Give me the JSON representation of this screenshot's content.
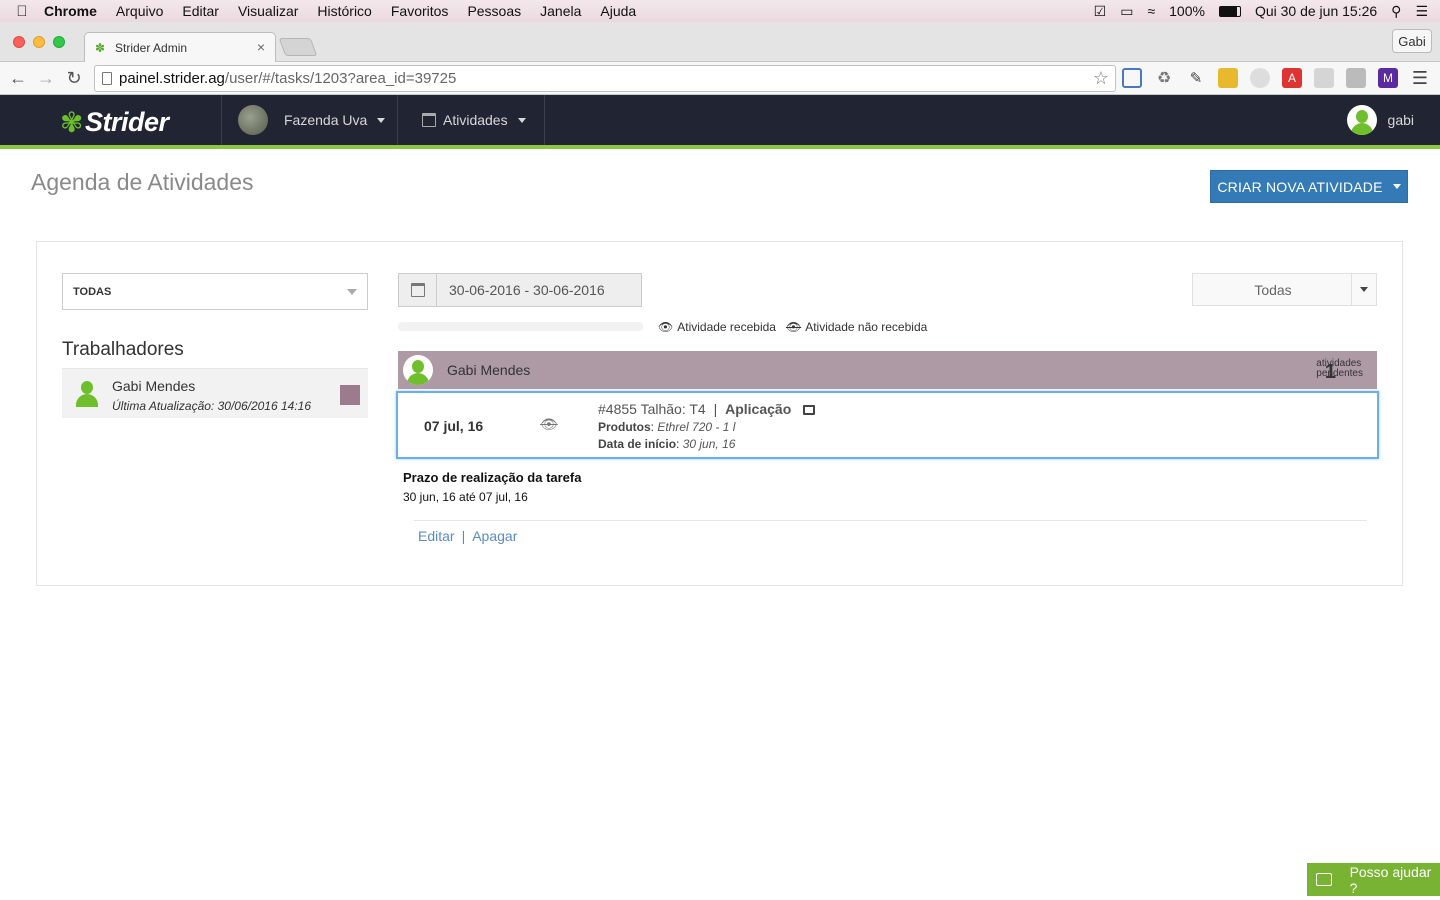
{
  "os_menubar": {
    "app_name": "Chrome",
    "menus": [
      "Arquivo",
      "Editar",
      "Visualizar",
      "Histórico",
      "Favoritos",
      "Pessoas",
      "Janela",
      "Ajuda"
    ],
    "battery": "100%",
    "clock": "Qui 30 de jun  15:26"
  },
  "browser": {
    "tab_title": "Strider Admin",
    "profile_label": "Gabi",
    "url_host": "painel.strider.ag",
    "url_path": "/user/#/tasks/1203?area_id=39725"
  },
  "app": {
    "logo_text": "Strider",
    "farm_label": "Fazenda Uva",
    "activities_label": "Atividades",
    "user_label": "gabi",
    "accent_color": "#8dc63f",
    "header_color": "#212533"
  },
  "page": {
    "title": "Agenda de Atividades",
    "create_button": "CRIAR NOVA ATIVIDADE"
  },
  "filters": {
    "worker_filter": "TODAS",
    "date_range": "30-06-2016 - 30-06-2016",
    "status_filter": "Todas",
    "progress_fraction": 0
  },
  "legend": {
    "received": "Atividade recebida",
    "not_received": "Atividade não recebida"
  },
  "workers": {
    "title": "Trabalhadores",
    "items": [
      {
        "name": "Gabi Mendes",
        "last_update": "Última Atualização: 30/06/2016 14:16",
        "color": "#9b7b8d"
      }
    ]
  },
  "group": {
    "name": "Gabi Mendes",
    "pending_count": "1",
    "pending_label_1": "atividades",
    "pending_label_2": "pendentes",
    "color": "#ae9aa5"
  },
  "task": {
    "date": "07 jul, 16",
    "id_plot": "#4855 Talhão: T4",
    "separator": "|",
    "type": "Aplicação",
    "products_label": "Produtos",
    "products_value": "Ethrel 720 - 1 l",
    "start_label": "Data de início",
    "start_value": "30 jun, 16"
  },
  "deadline": {
    "title": "Prazo de realização da tarefa",
    "value": "30 jun, 16 até 07 jul, 16"
  },
  "actions": {
    "edit": "Editar",
    "separator": "|",
    "delete": "Apagar"
  },
  "help_widget": {
    "label": "Posso ajudar ?"
  }
}
